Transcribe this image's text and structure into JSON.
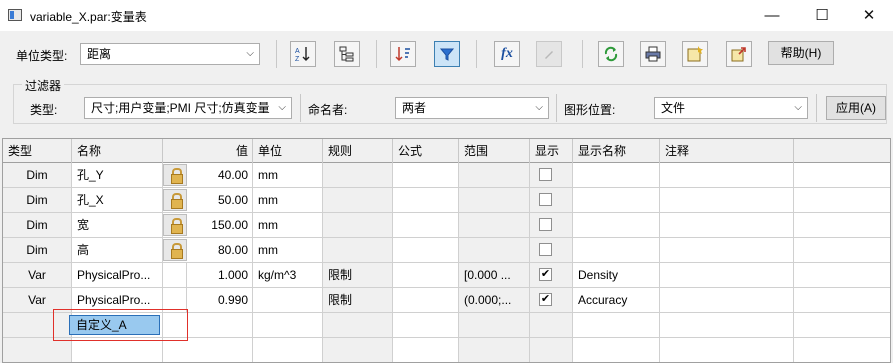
{
  "window": {
    "title": "variable_X.par:变量表",
    "min_glyph": "—",
    "max_glyph": "☐",
    "close_glyph": "✕"
  },
  "toolbar": {
    "unit_type_label": "单位类型:",
    "unit_type_value": "距离",
    "icons": [
      "sort-az-icon",
      "tree-view-icon",
      "sort-order-icon",
      "filter-icon",
      "formula-icon",
      "edit-disabled-icon",
      "refresh-icon",
      "print-icon",
      "add-to-view-icon",
      "export-icon"
    ],
    "formula_glyph": "fx",
    "help_label": "帮助(H)"
  },
  "filter": {
    "group_label": "过滤器",
    "type_label": "类型:",
    "type_value": "尺寸;用户变量;PMI 尺寸;仿真变量",
    "name_label": "命名者:",
    "name_value": "两者",
    "location_label": "图形位置:",
    "location_value": "文件",
    "apply_label": "应用(A)"
  },
  "table": {
    "headers": [
      "类型",
      "名称",
      "值",
      "单位",
      "规则",
      "公式",
      "范围",
      "显示",
      "显示名称",
      "注释"
    ],
    "rows": [
      {
        "type": "Dim",
        "name": "孔_Y",
        "value": "40.00",
        "unit": "mm",
        "rule": "",
        "formula": "",
        "range": "",
        "show": false,
        "display_name": "",
        "note": "",
        "locked": true
      },
      {
        "type": "Dim",
        "name": "孔_X",
        "value": "50.00",
        "unit": "mm",
        "rule": "",
        "formula": "",
        "range": "",
        "show": false,
        "display_name": "",
        "note": "",
        "locked": true
      },
      {
        "type": "Dim",
        "name": "宽",
        "value": "150.00",
        "unit": "mm",
        "rule": "",
        "formula": "",
        "range": "",
        "show": false,
        "display_name": "",
        "note": "",
        "locked": true
      },
      {
        "type": "Dim",
        "name": "高",
        "value": "80.00",
        "unit": "mm",
        "rule": "",
        "formula": "",
        "range": "",
        "show": false,
        "display_name": "",
        "note": "",
        "locked": true
      },
      {
        "type": "Var",
        "name": "PhysicalPro...",
        "value": "1.000",
        "unit": "kg/m^3",
        "rule": "限制",
        "formula": "",
        "range": "[0.000 ...",
        "show": true,
        "display_name": "Density",
        "note": "",
        "locked": false
      },
      {
        "type": "Var",
        "name": "PhysicalPro...",
        "value": "0.990",
        "unit": "",
        "rule": "限制",
        "formula": "",
        "range": "(0.000;...",
        "show": true,
        "display_name": "Accuracy",
        "note": "",
        "locked": false
      }
    ],
    "new_row_name": "自定义_A",
    "check_glyph": "✔"
  }
}
